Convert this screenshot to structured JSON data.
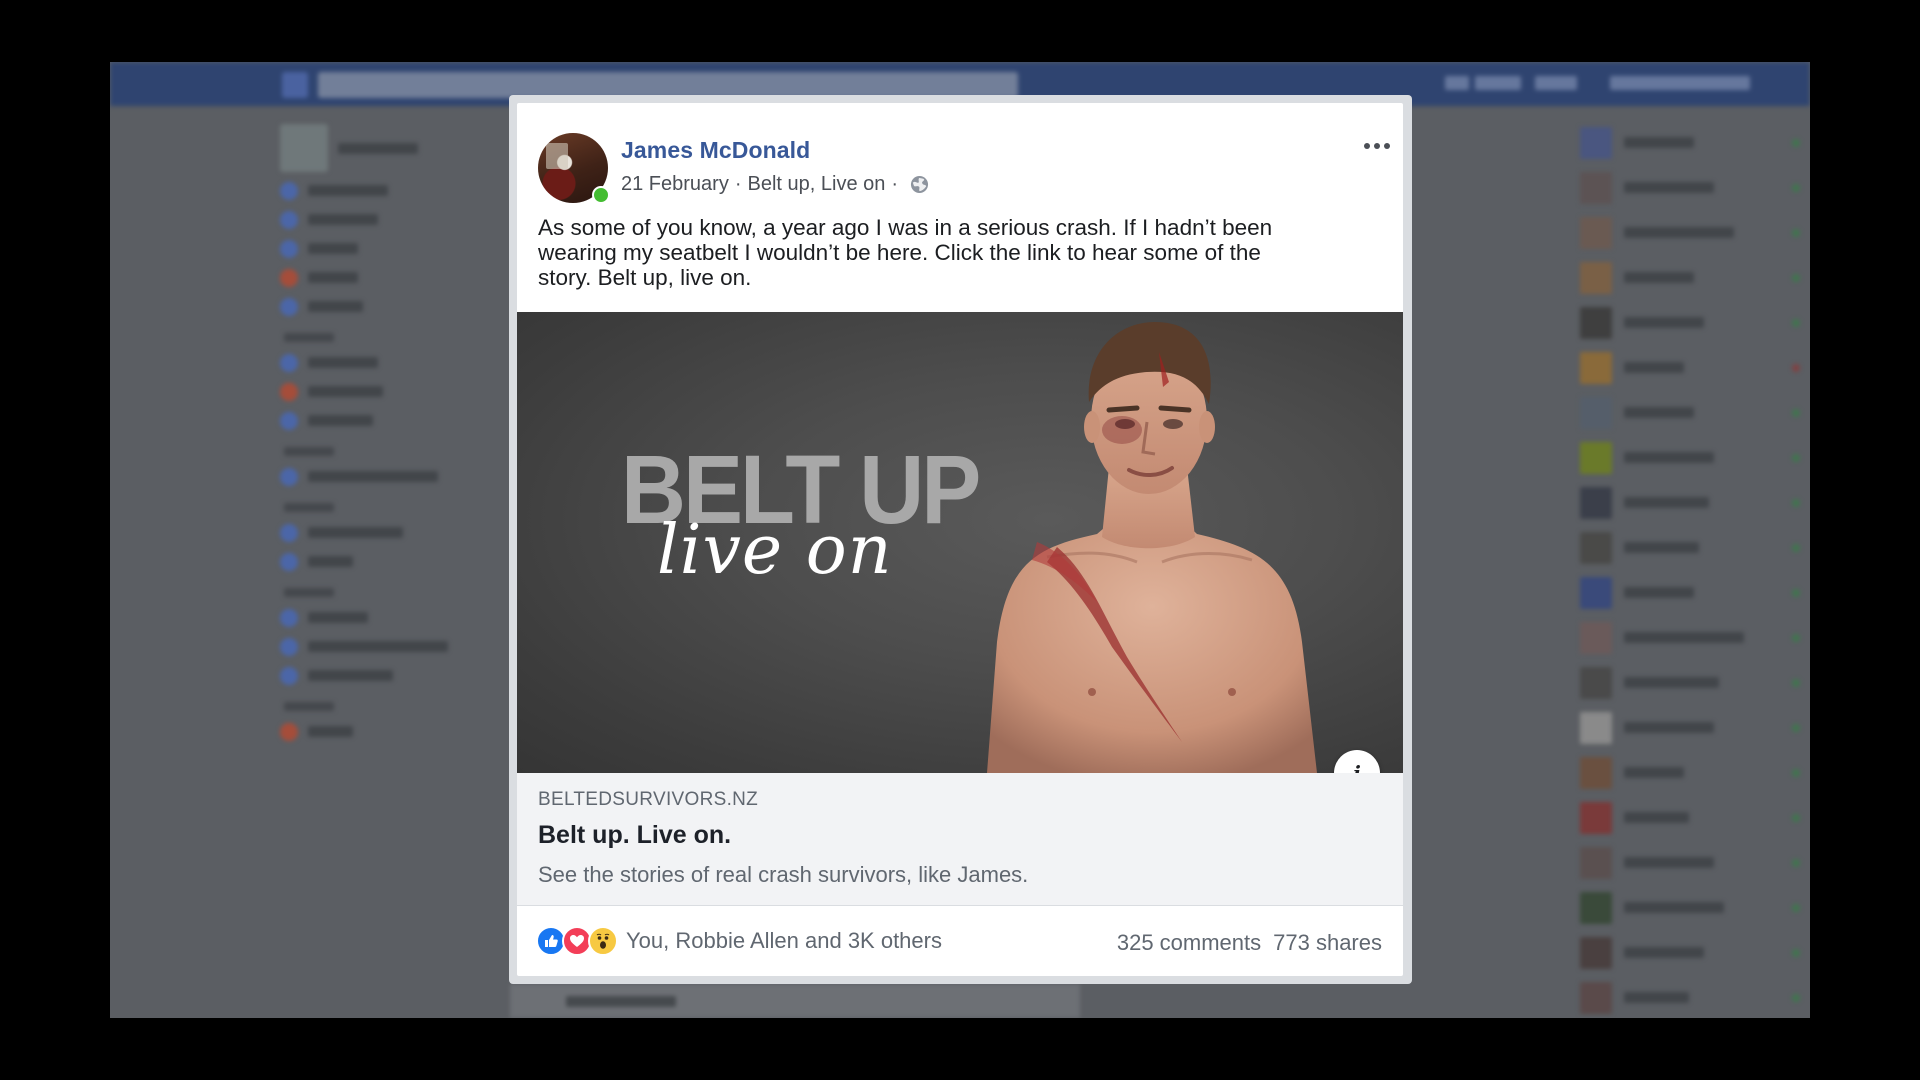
{
  "post": {
    "author": "James McDonald",
    "date": "21 February",
    "separator": "·",
    "campaign": "Belt up, Live on",
    "separator2": "·",
    "privacy_icon": "globe-icon",
    "more_icon": "more-options-icon",
    "text": "As some of you know, a year ago I was in a serious crash. If I hadn’t been\nwearing my seatbelt I wouldn’t be here. Click the link to hear some of the\nstory. Belt up, live on."
  },
  "link": {
    "image_title": "BELT UP",
    "image_script": "live on",
    "domain": "BELTEDSURVIVORS.NZ",
    "title": "Belt up. Live on.",
    "description": "See the stories of real crash survivors, like James.",
    "info_icon": "info-icon"
  },
  "footer": {
    "reaction_icons": [
      "like-icon",
      "love-icon",
      "wow-icon"
    ],
    "reactions_text": "You, Robbie Allen and 3K others",
    "comments": "325 comments",
    "shares": "773 shares"
  },
  "colors": {
    "author": "#385898",
    "online": "#44bd32",
    "like": "#1877f2",
    "love": "#f33e58",
    "wow": "#f7c942",
    "topbar": "#2f4470"
  }
}
